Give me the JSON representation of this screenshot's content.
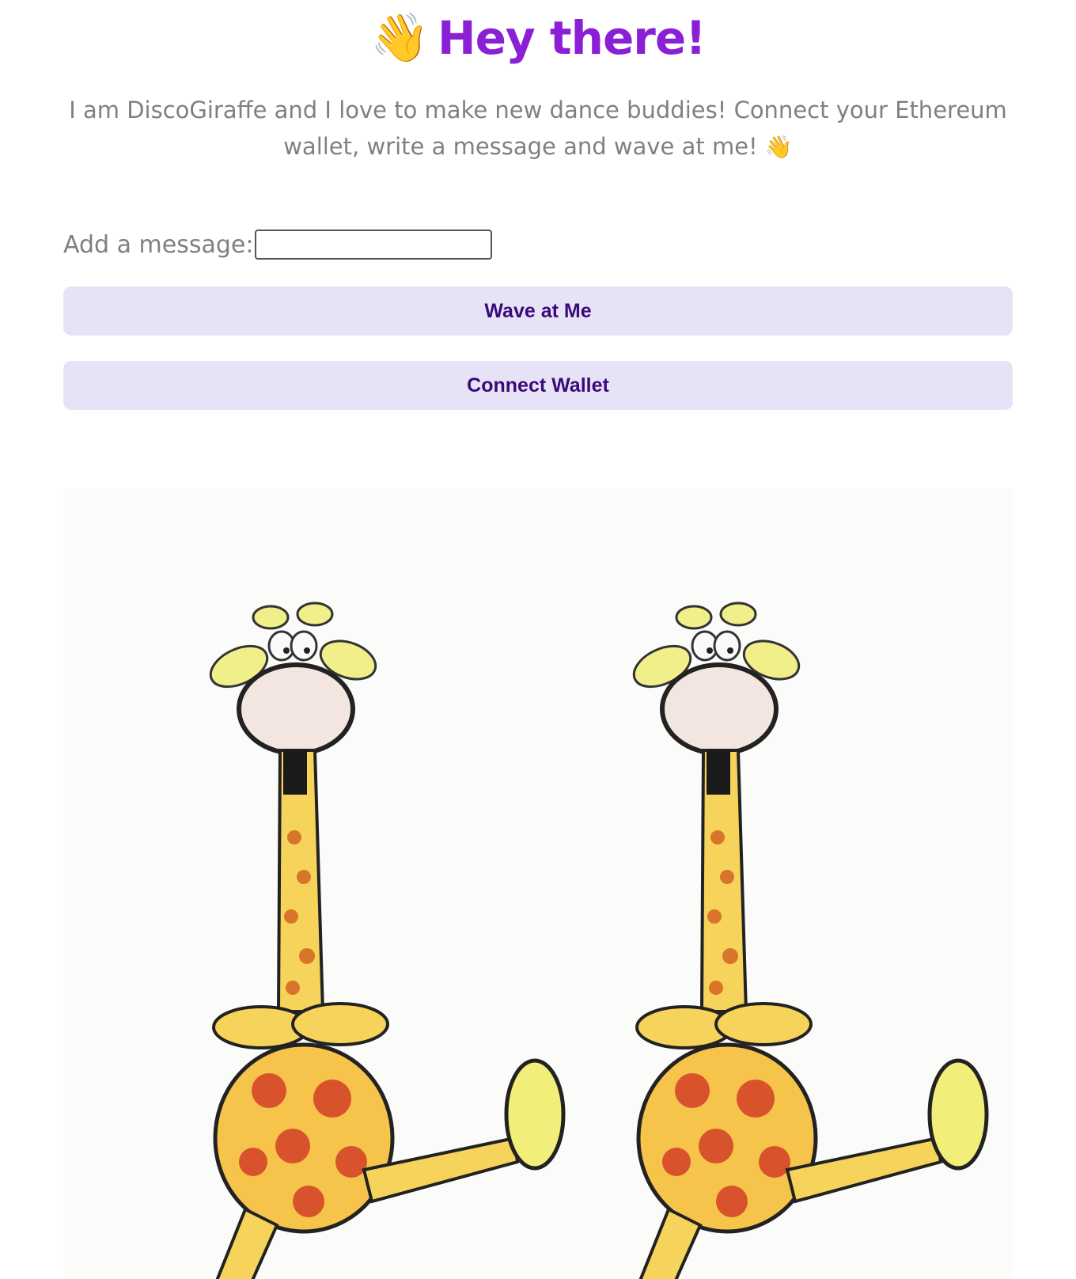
{
  "header": {
    "emoji": "👋",
    "title": "Hey there!"
  },
  "intro": {
    "text": "I am DiscoGiraffe and I love to make new dance buddies! Connect your Ethereum wallet, write a message and wave at me!",
    "emoji": "👋"
  },
  "message": {
    "label": "Add a message:",
    "value": "",
    "placeholder": ""
  },
  "buttons": {
    "wave_label": "Wave at Me",
    "connect_label": "Connect Wallet"
  },
  "colors": {
    "title": "#8a1fd6",
    "button_bg": "#e6e3f7",
    "button_text": "#3b0a7a",
    "muted_text": "#808080"
  },
  "image": {
    "subject": "two dancing cartoon giraffes"
  }
}
